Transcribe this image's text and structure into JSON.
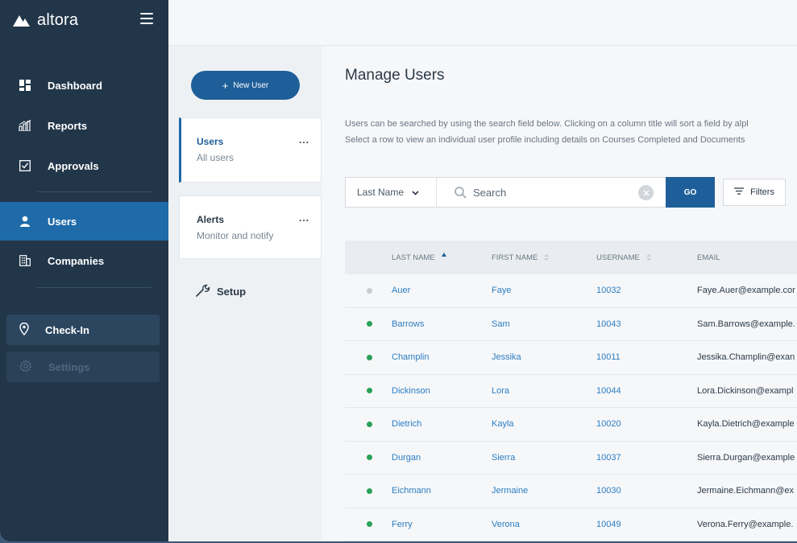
{
  "brand": {
    "name": "altora"
  },
  "sidebar": {
    "items": [
      {
        "label": "Dashboard",
        "icon": "dashboard-icon"
      },
      {
        "label": "Reports",
        "icon": "reports-icon"
      },
      {
        "label": "Approvals",
        "icon": "approvals-icon"
      },
      {
        "label": "Users",
        "icon": "user-icon",
        "active": true
      },
      {
        "label": "Companies",
        "icon": "companies-icon"
      }
    ],
    "checkin": {
      "label": "Check-In",
      "icon": "location-pin-icon"
    },
    "settings": {
      "label": "Settings",
      "icon": "gear-icon",
      "disabled": true
    }
  },
  "panel": {
    "new_user_label": "New User",
    "new_user_icon": "plus-icon",
    "cards": [
      {
        "title": "Users",
        "subtitle": "All users",
        "more": "...",
        "active": true
      },
      {
        "title": "Alerts",
        "subtitle": "Monitor and notify",
        "more": "..."
      }
    ],
    "setup_label": "Setup",
    "setup_icon": "wrench-icon"
  },
  "main": {
    "title": "Manage Users",
    "description_line1": "Users can be searched by using the search field below. Clicking on a column title will sort a field by alpl",
    "description_line2": "Select a row to view an individual user profile including details on Courses Completed and Documents",
    "search": {
      "field_select": "Last Name",
      "placeholder": "Search",
      "go_label": "GO",
      "filters_label": "Filters"
    },
    "table": {
      "columns": [
        "LAST NAME",
        "FIRST NAME",
        "USERNAME",
        "EMAIL"
      ],
      "sorted_column": "LAST NAME",
      "rows": [
        {
          "status": "inactive",
          "last": "Auer",
          "first": "Faye",
          "username": "10032",
          "email": "Faye.Auer@example.cor"
        },
        {
          "status": "active",
          "last": "Barrows",
          "first": "Sam",
          "username": "10043",
          "email": "Sam.Barrows@example."
        },
        {
          "status": "active",
          "last": "Champlin",
          "first": "Jessika",
          "username": "10011",
          "email": "Jessika.Champlin@exan"
        },
        {
          "status": "active",
          "last": "Dickinson",
          "first": "Lora",
          "username": "10044",
          "email": "Lora.Dickinson@exampl"
        },
        {
          "status": "active",
          "last": "Dietrich",
          "first": "Kayla",
          "username": "10020",
          "email": "Kayla.Dietrich@example"
        },
        {
          "status": "active",
          "last": "Durgan",
          "first": "Sierra",
          "username": "10037",
          "email": "Sierra.Durgan@example"
        },
        {
          "status": "active",
          "last": "Eichmann",
          "first": "Jermaine",
          "username": "10030",
          "email": "Jermaine.Eichmann@ex"
        },
        {
          "status": "active",
          "last": "Ferry",
          "first": "Verona",
          "username": "10049",
          "email": "Verona.Ferry@example."
        }
      ]
    }
  },
  "colors": {
    "sidebar_bg": "#22364a",
    "active_nav": "#1f6aa8",
    "primary_button": "#1f5f99",
    "link": "#2a7ec3",
    "status_active": "#2aa05a",
    "status_inactive": "#c8cdd2"
  }
}
